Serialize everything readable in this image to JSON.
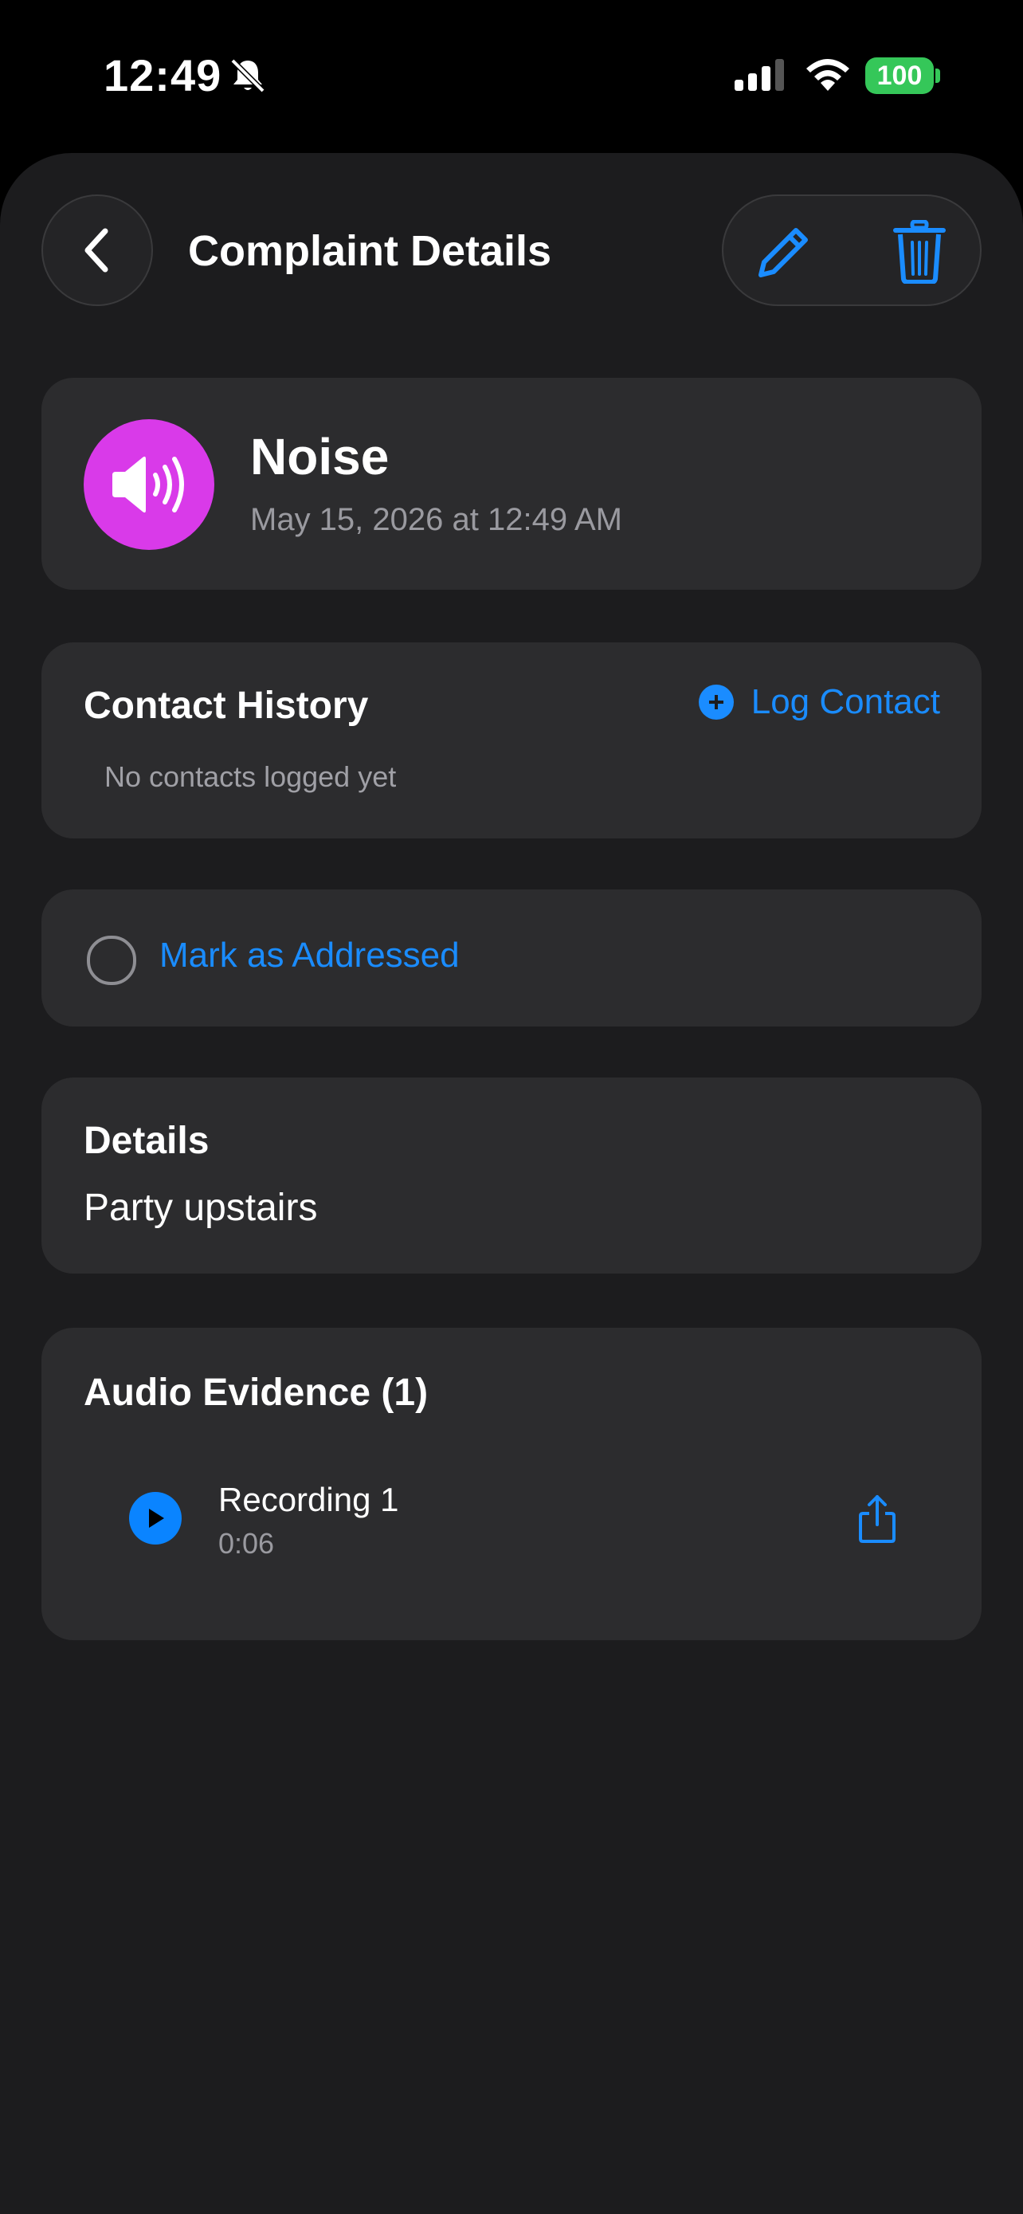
{
  "status_bar": {
    "time": "12:49",
    "battery": "100",
    "icons": [
      "bell-slash-icon",
      "cellular-signal-icon",
      "wifi-icon",
      "battery-icon"
    ]
  },
  "nav": {
    "title": "Complaint Details",
    "back_icon": "chevron-left-icon",
    "edit_icon": "pencil-icon",
    "delete_icon": "trash-icon"
  },
  "complaint": {
    "type": "Noise",
    "date": "May 15, 2026 at 12:49 AM",
    "icon": "speaker-wave-icon",
    "icon_color": "#d93ae9"
  },
  "contact_history": {
    "title": "Contact History",
    "action_label": "Log Contact",
    "empty_text": "No contacts logged yet"
  },
  "address": {
    "label": "Mark as Addressed",
    "checked": false
  },
  "details": {
    "title": "Details",
    "text": "Party upstairs"
  },
  "audio": {
    "title": "Audio Evidence (1)",
    "recordings": [
      {
        "name": "Recording 1",
        "duration": "0:06"
      }
    ]
  },
  "colors": {
    "accent": "#1a8cff",
    "background": "#1c1c1e",
    "card": "#2c2c2e",
    "battery": "#35c759"
  }
}
